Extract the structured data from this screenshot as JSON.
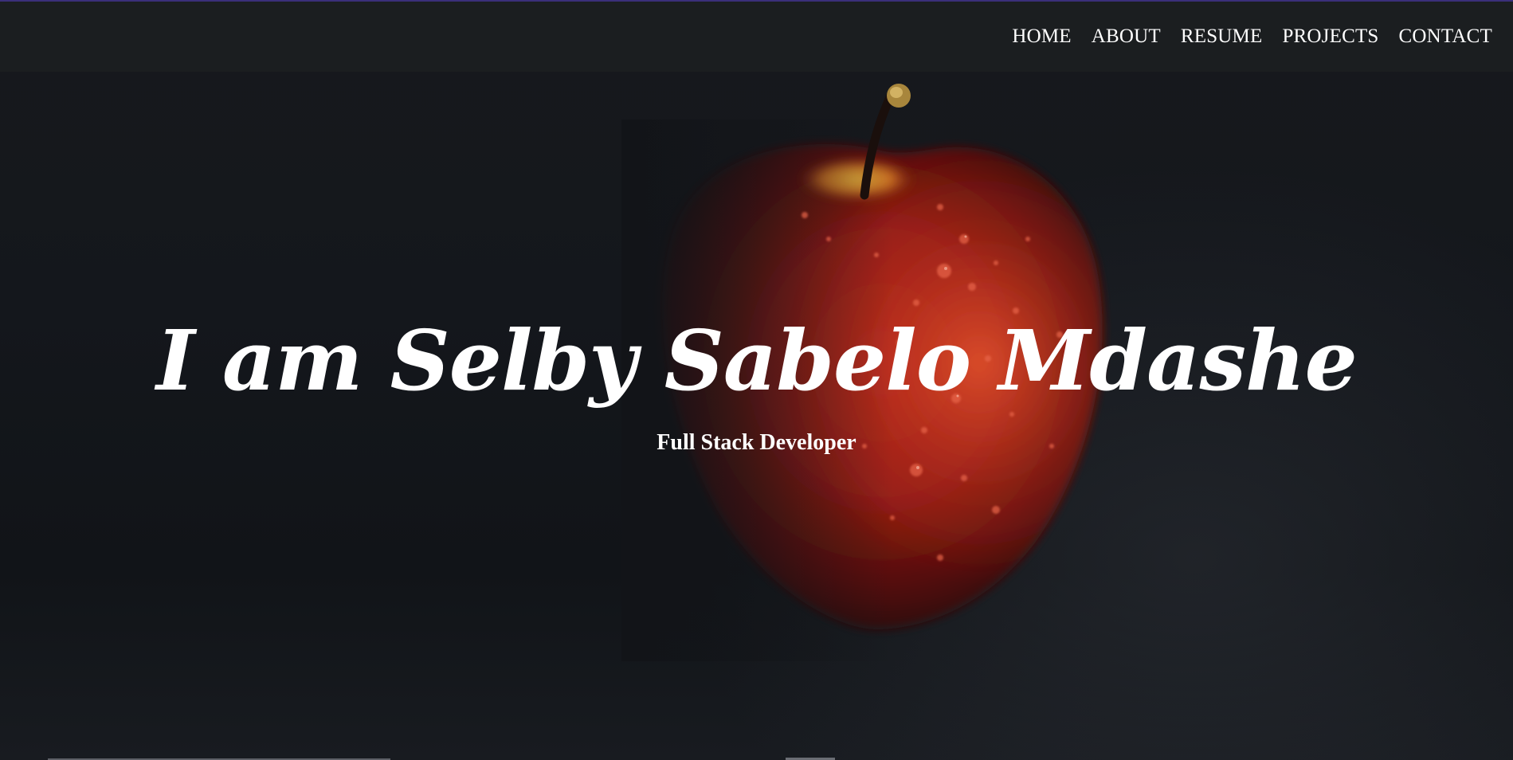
{
  "nav": {
    "items": [
      {
        "label": "HOME"
      },
      {
        "label": "ABOUT"
      },
      {
        "label": "RESUME"
      },
      {
        "label": "PROJECTS"
      },
      {
        "label": "CONTACT"
      }
    ]
  },
  "hero": {
    "title": "I am Selby Sabelo Mdashe",
    "subtitle": "Full Stack Developer",
    "background_image": "apple-photo"
  },
  "colors": {
    "background": "#121418",
    "navbar": "#1c1e21",
    "text": "#ffffff",
    "accent": "#3a2f7a",
    "apple_red": "#b0241a"
  }
}
